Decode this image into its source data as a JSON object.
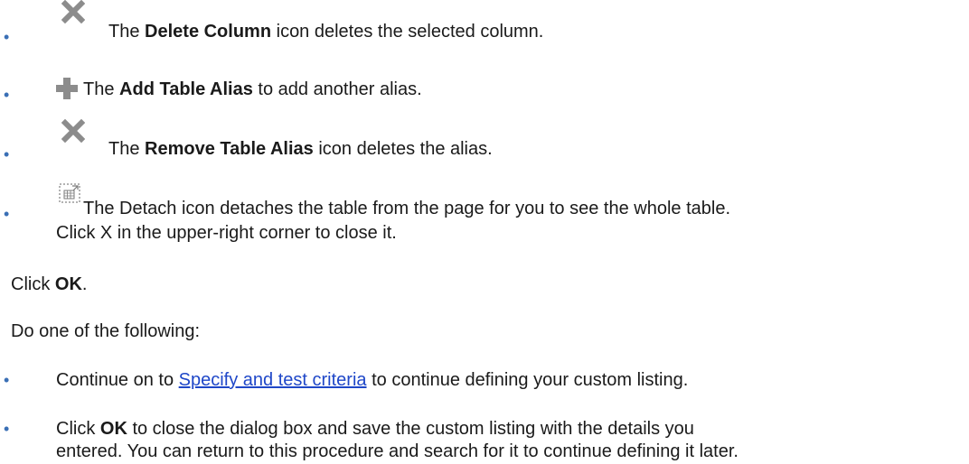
{
  "items": [
    {
      "icon": "delete-x-icon",
      "pre": "The ",
      "bold": "Delete Column",
      "post": " icon deletes the selected column."
    },
    {
      "icon": "add-plus-icon",
      "pre": "The ",
      "bold": "Add Table Alias",
      "post": " to add another alias."
    },
    {
      "icon": "delete-x-icon",
      "pre": "The ",
      "bold": "Remove Table Alias",
      "post": " icon deletes the alias."
    },
    {
      "icon": "detach-icon",
      "line1": "The Detach icon detaches the table from the page for you to see the whole table.",
      "line2": "Click X in the upper-right corner to close it."
    }
  ],
  "click_ok": {
    "pre": "Click ",
    "bold": "OK",
    "post": "."
  },
  "do_one": "Do one of the following:",
  "options": [
    {
      "pre": "Continue on to ",
      "link": "Specify and test criteria",
      "post": " to continue defining your custom listing."
    },
    {
      "pre": "Click ",
      "bold": "OK",
      "line1_post": " to close the dialog box and save the custom listing with the details you",
      "line2": "entered. You can return to this procedure and search for it to continue defining it later."
    }
  ],
  "colors": {
    "bullet": "#3a6fb5",
    "link": "#1f47c8",
    "icon_gray": "#8c8c8c"
  }
}
